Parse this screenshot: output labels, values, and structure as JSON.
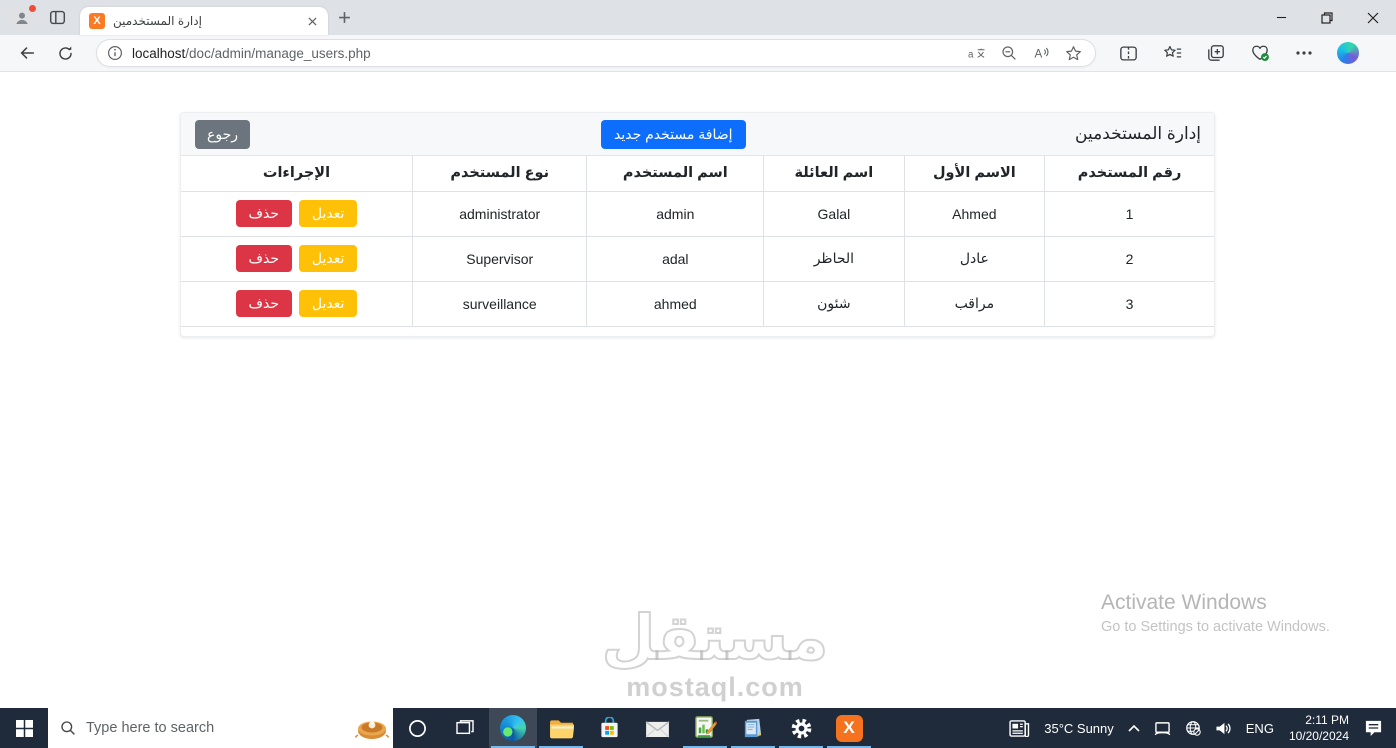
{
  "browser": {
    "tab_title": "إدارة المستخدمين",
    "url_host": "localhost",
    "url_path": "/doc/admin/manage_users.php"
  },
  "page": {
    "title": "إدارة المستخدمين",
    "add_user_button": "إضافة مستخدم جديد",
    "back_button": "رجوع",
    "table": {
      "headers": [
        "رقم المستخدم",
        "الاسم الأول",
        "اسم العائلة",
        "اسم المستخدم",
        "نوع المستخدم",
        "الإجراءات"
      ],
      "edit_label": "تعديل",
      "delete_label": "حذف",
      "rows": [
        {
          "id": "1",
          "first_name": "Ahmed",
          "family_name": "Galal",
          "username": "admin",
          "user_type": "administrator"
        },
        {
          "id": "2",
          "first_name": "عادل",
          "family_name": "الحاظر",
          "username": "adal",
          "user_type": "Supervisor"
        },
        {
          "id": "3",
          "first_name": "مراقب",
          "family_name": "شئون",
          "username": "ahmed",
          "user_type": "surveillance"
        }
      ]
    }
  },
  "watermark": {
    "name": "مستقل",
    "domain": "mostaql.com"
  },
  "activation": {
    "title": "Activate Windows",
    "subtitle": "Go to Settings to activate Windows."
  },
  "taskbar": {
    "search_placeholder": "Type here to search",
    "weather": "35°C Sunny",
    "language": "ENG",
    "time": "2:11 PM",
    "date": "10/20/2024"
  },
  "colors": {
    "accent_blue": "#0d6efd",
    "warning_yellow": "#ffc107",
    "danger_red": "#dc3545",
    "secondary_gray": "#6c757d",
    "xampp_orange": "#fb7a24",
    "taskbar_bg": "#1f2b3b"
  }
}
